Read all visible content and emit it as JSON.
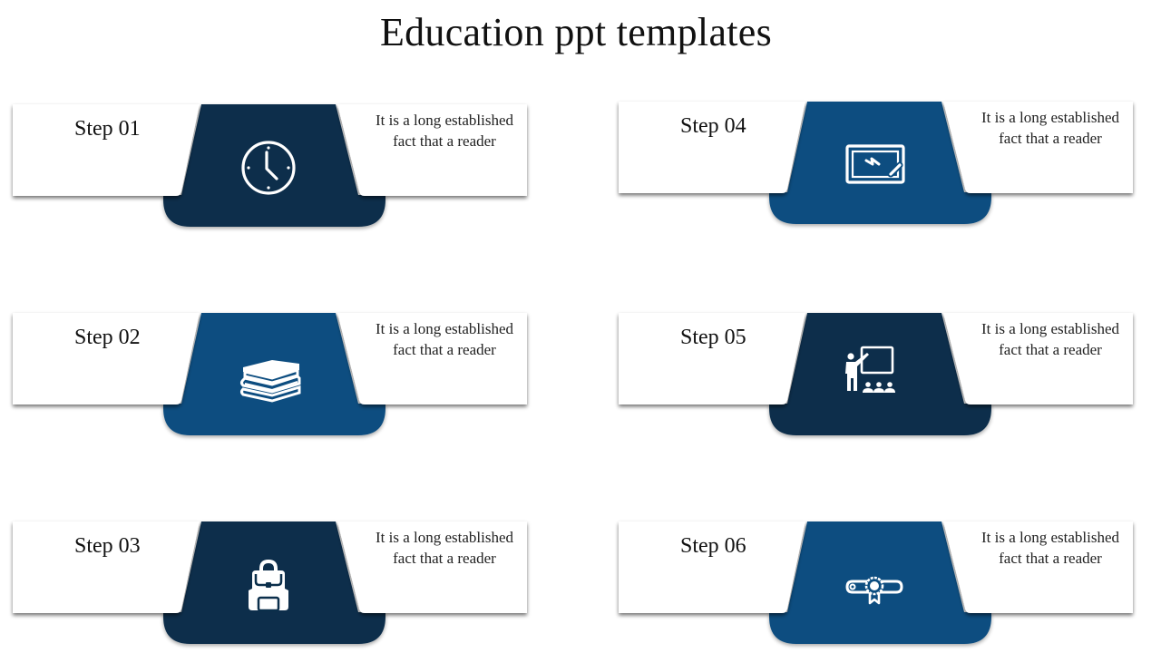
{
  "title": "Education ppt templates",
  "colors": {
    "dark": "#0b2f4b",
    "medium": "#0b4d80"
  },
  "steps": [
    {
      "label": "Step 01",
      "description_line1": "It is a long established",
      "description_line2": "fact that  a reader",
      "icon": "clock-icon",
      "color": "dark"
    },
    {
      "label": "Step 02",
      "description_line1": "It is a long established",
      "description_line2": "fact that  a reader",
      "icon": "books-icon",
      "color": "medium"
    },
    {
      "label": "Step 03",
      "description_line1": "It is a long established",
      "description_line2": "fact that  a reader",
      "icon": "backpack-icon",
      "color": "dark"
    },
    {
      "label": "Step 04",
      "description_line1": "It is a long established",
      "description_line2": "fact that  a reader",
      "icon": "whiteboard-icon",
      "color": "medium"
    },
    {
      "label": "Step 05",
      "description_line1": "It is a long established",
      "description_line2": "fact that  a reader",
      "icon": "teacher-icon",
      "color": "dark"
    },
    {
      "label": "Step 06",
      "description_line1": "It is a long established",
      "description_line2": "fact that  a reader",
      "icon": "diploma-icon",
      "color": "medium"
    }
  ]
}
